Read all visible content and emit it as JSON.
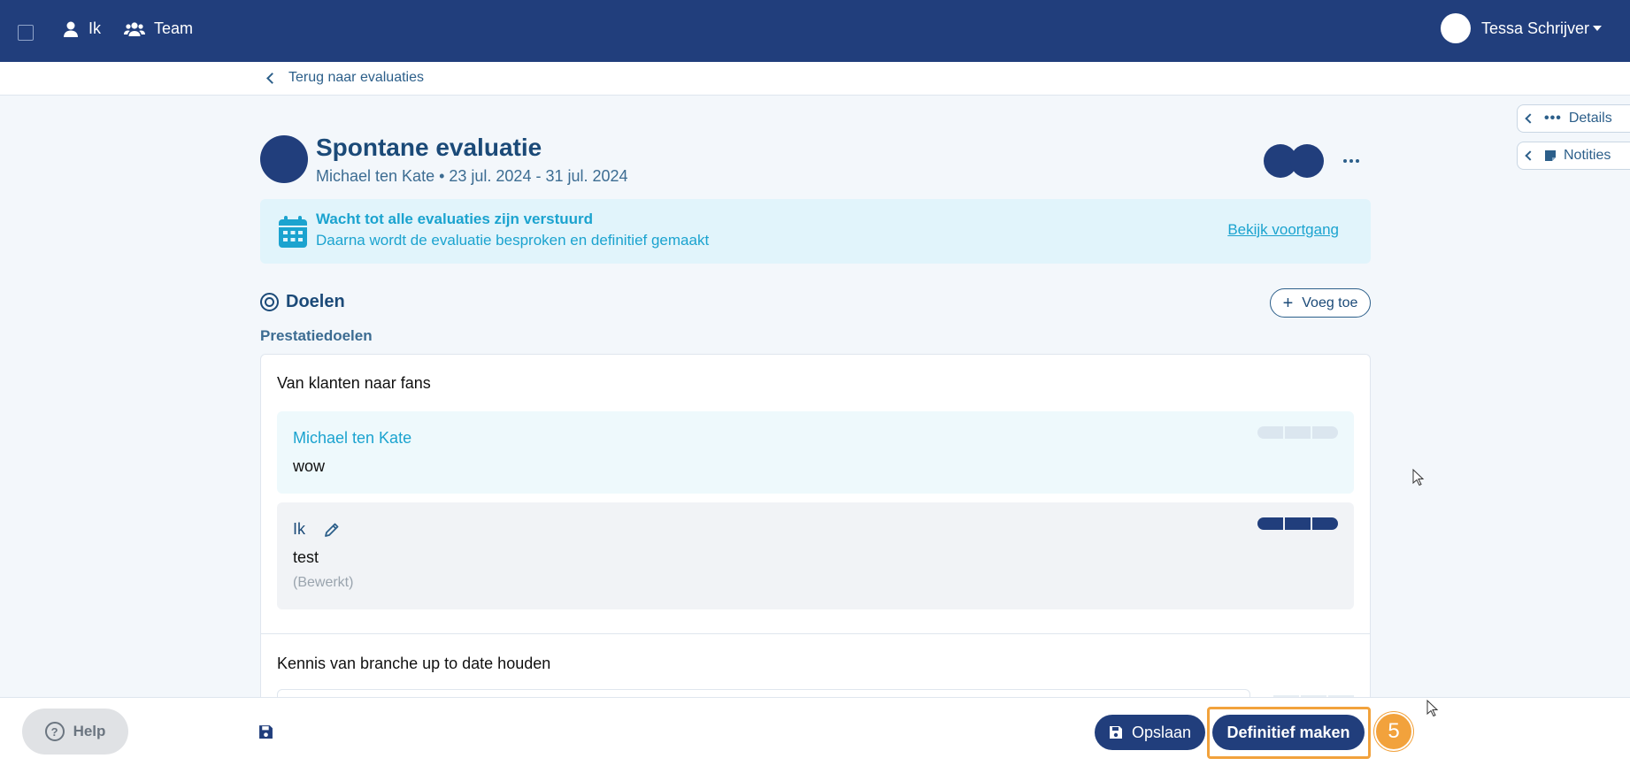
{
  "nav": {
    "items": [
      {
        "label": "Ik",
        "icon": "user-icon"
      },
      {
        "label": "Team",
        "icon": "users-icon"
      }
    ],
    "user_name": "Tessa Schrijver"
  },
  "breadcrumb": {
    "back_label": "Terug naar evaluaties"
  },
  "side_tabs": [
    {
      "label": "Details",
      "icon": "ellipsis-icon"
    },
    {
      "label": "Notities",
      "icon": "note-icon"
    }
  ],
  "header": {
    "title": "Spontane evaluatie",
    "subtitle": "Michael ten Kate • 23 jul. 2024 - 31 jul. 2024"
  },
  "banner": {
    "title": "Wacht tot alle evaluaties zijn verstuurd",
    "text": "Daarna wordt de evaluatie besproken en definitief gemaakt",
    "link": "Bekijk voortgang"
  },
  "goals": {
    "section_title": "Doelen",
    "add_label": "Voeg toe",
    "subsection": "Prestatiedoelen",
    "items": [
      {
        "title": "Van klanten naar fans",
        "entries": [
          {
            "author": "Michael ten Kate",
            "text": "wow",
            "rating": 0
          },
          {
            "author": "Ik",
            "text": "test",
            "meta": "(Bewerkt)",
            "rating": 3
          }
        ]
      },
      {
        "title": "Kennis van branche up to date houden"
      }
    ]
  },
  "footer": {
    "help_label": "Help",
    "save_label": "Opslaan",
    "finalize_label": "Definitief maken",
    "step_number": "5"
  },
  "colors": {
    "brand": "#213e7c",
    "accent": "#1ba3cf",
    "highlight": "#f2a23c"
  }
}
